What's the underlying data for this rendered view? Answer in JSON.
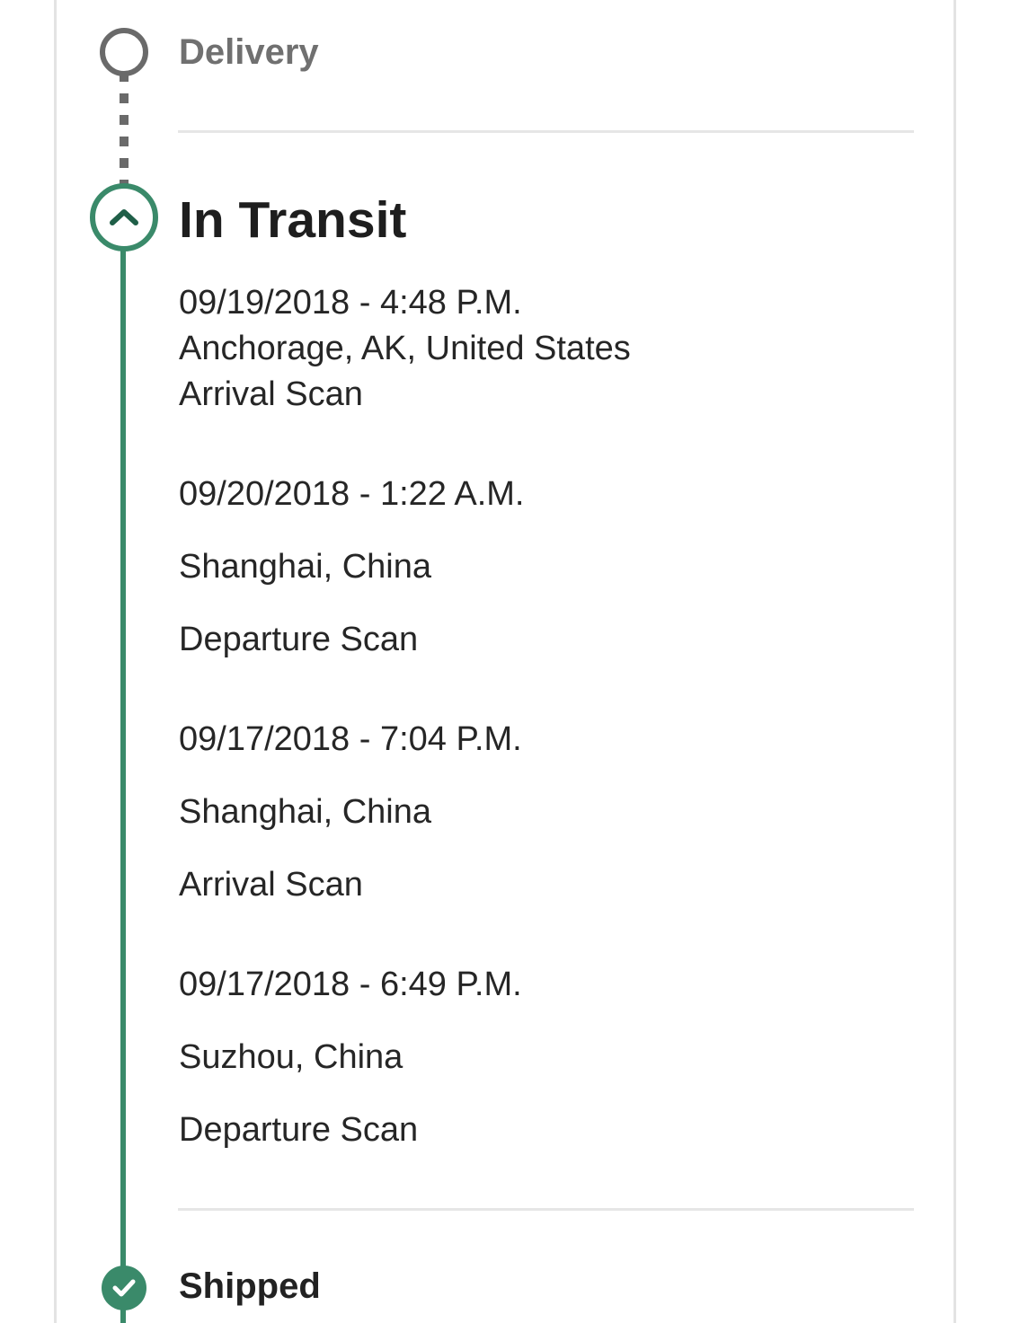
{
  "timeline": {
    "delivery": {
      "label": "Delivery",
      "status": "pending"
    },
    "in_transit": {
      "label": "In Transit",
      "status": "current",
      "events": [
        {
          "datetime": "09/19/2018 - 4:48 P.M.",
          "location": "Anchorage, AK, United States",
          "activity": "Arrival Scan"
        },
        {
          "datetime": "09/20/2018 - 1:22 A.M.",
          "location": "Shanghai, China",
          "activity": "Departure Scan"
        },
        {
          "datetime": "09/17/2018 - 7:04 P.M.",
          "location": "Shanghai, China",
          "activity": "Arrival Scan"
        },
        {
          "datetime": "09/17/2018 - 6:49 P.M.",
          "location": "Suzhou, China",
          "activity": "Departure Scan"
        }
      ]
    },
    "shipped": {
      "label": "Shipped",
      "status": "complete"
    }
  },
  "icons": {
    "pending": "empty-circle-icon",
    "current": "chevron-up-icon",
    "done": "check-circle-icon"
  },
  "colors": {
    "accent": "#3a8a6a",
    "pending": "#6a6a6a",
    "divider": "#e6e6e6"
  }
}
